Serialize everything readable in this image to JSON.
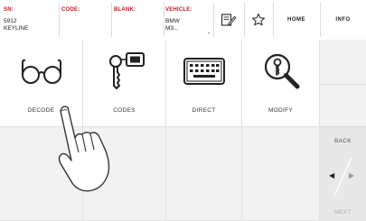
{
  "header": {
    "sn_label": "SN:",
    "sn_value": "5912",
    "sn_value2": "KEYLINE",
    "code_label": "CODE:",
    "blank_label": "BLANK:",
    "vehicle_label": "VEHICLE:",
    "vehicle_value": "BMW",
    "vehicle_value2": "M3...",
    "home_label": "HOME",
    "info_label": "INFO",
    "accent_color": "#c4162a"
  },
  "functions": [
    {
      "label": "DECODE",
      "icon": "glasses-icon"
    },
    {
      "label": "CODES",
      "icon": "key-tag-icon"
    },
    {
      "label": "DIRECT",
      "icon": "keyboard-icon"
    },
    {
      "label": "MODIFY",
      "icon": "magnifier-key-icon"
    }
  ],
  "side": {
    "back_label": "BACK",
    "next_label": "NEXT"
  }
}
